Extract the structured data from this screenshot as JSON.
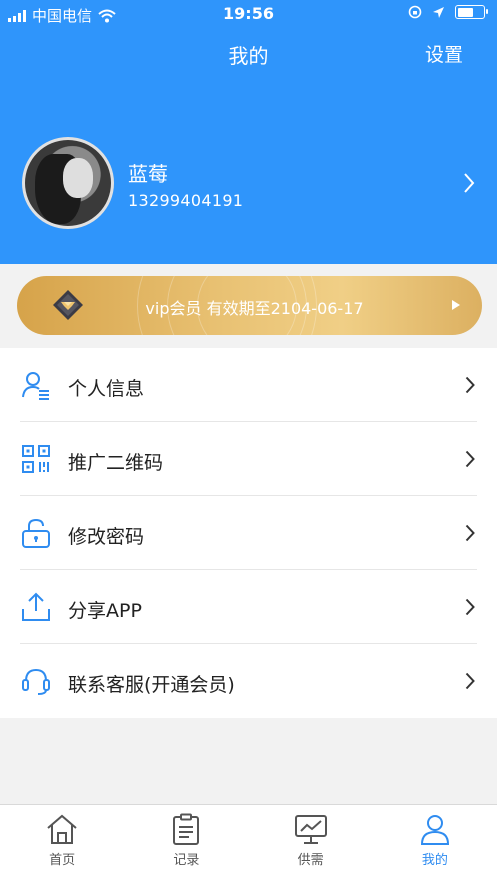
{
  "status_bar": {
    "carrier": "中国电信",
    "time": "19:56"
  },
  "header": {
    "title": "我的",
    "settings_label": "设置"
  },
  "profile": {
    "name": "蓝莓",
    "phone": "13299404191"
  },
  "vip": {
    "text": "vip会员 有效期至2104-06-17"
  },
  "menu": {
    "items": [
      {
        "label": "个人信息",
        "icon": "user-info-icon"
      },
      {
        "label": "推广二维码",
        "icon": "qr-code-icon"
      },
      {
        "label": "修改密码",
        "icon": "lock-icon"
      },
      {
        "label": "分享APP",
        "icon": "share-icon"
      },
      {
        "label": "联系客服(开通会员)",
        "icon": "headset-icon"
      }
    ]
  },
  "tabbar": {
    "tabs": [
      {
        "label": "首页",
        "icon": "home-icon"
      },
      {
        "label": "记录",
        "icon": "clipboard-icon"
      },
      {
        "label": "供需",
        "icon": "monitor-chart-icon"
      },
      {
        "label": "我的",
        "icon": "person-icon",
        "active": true
      }
    ]
  },
  "colors": {
    "header_blue": "#2f95fb",
    "active_tab": "#2f8cf0",
    "vip_gold": "#e9c274"
  }
}
